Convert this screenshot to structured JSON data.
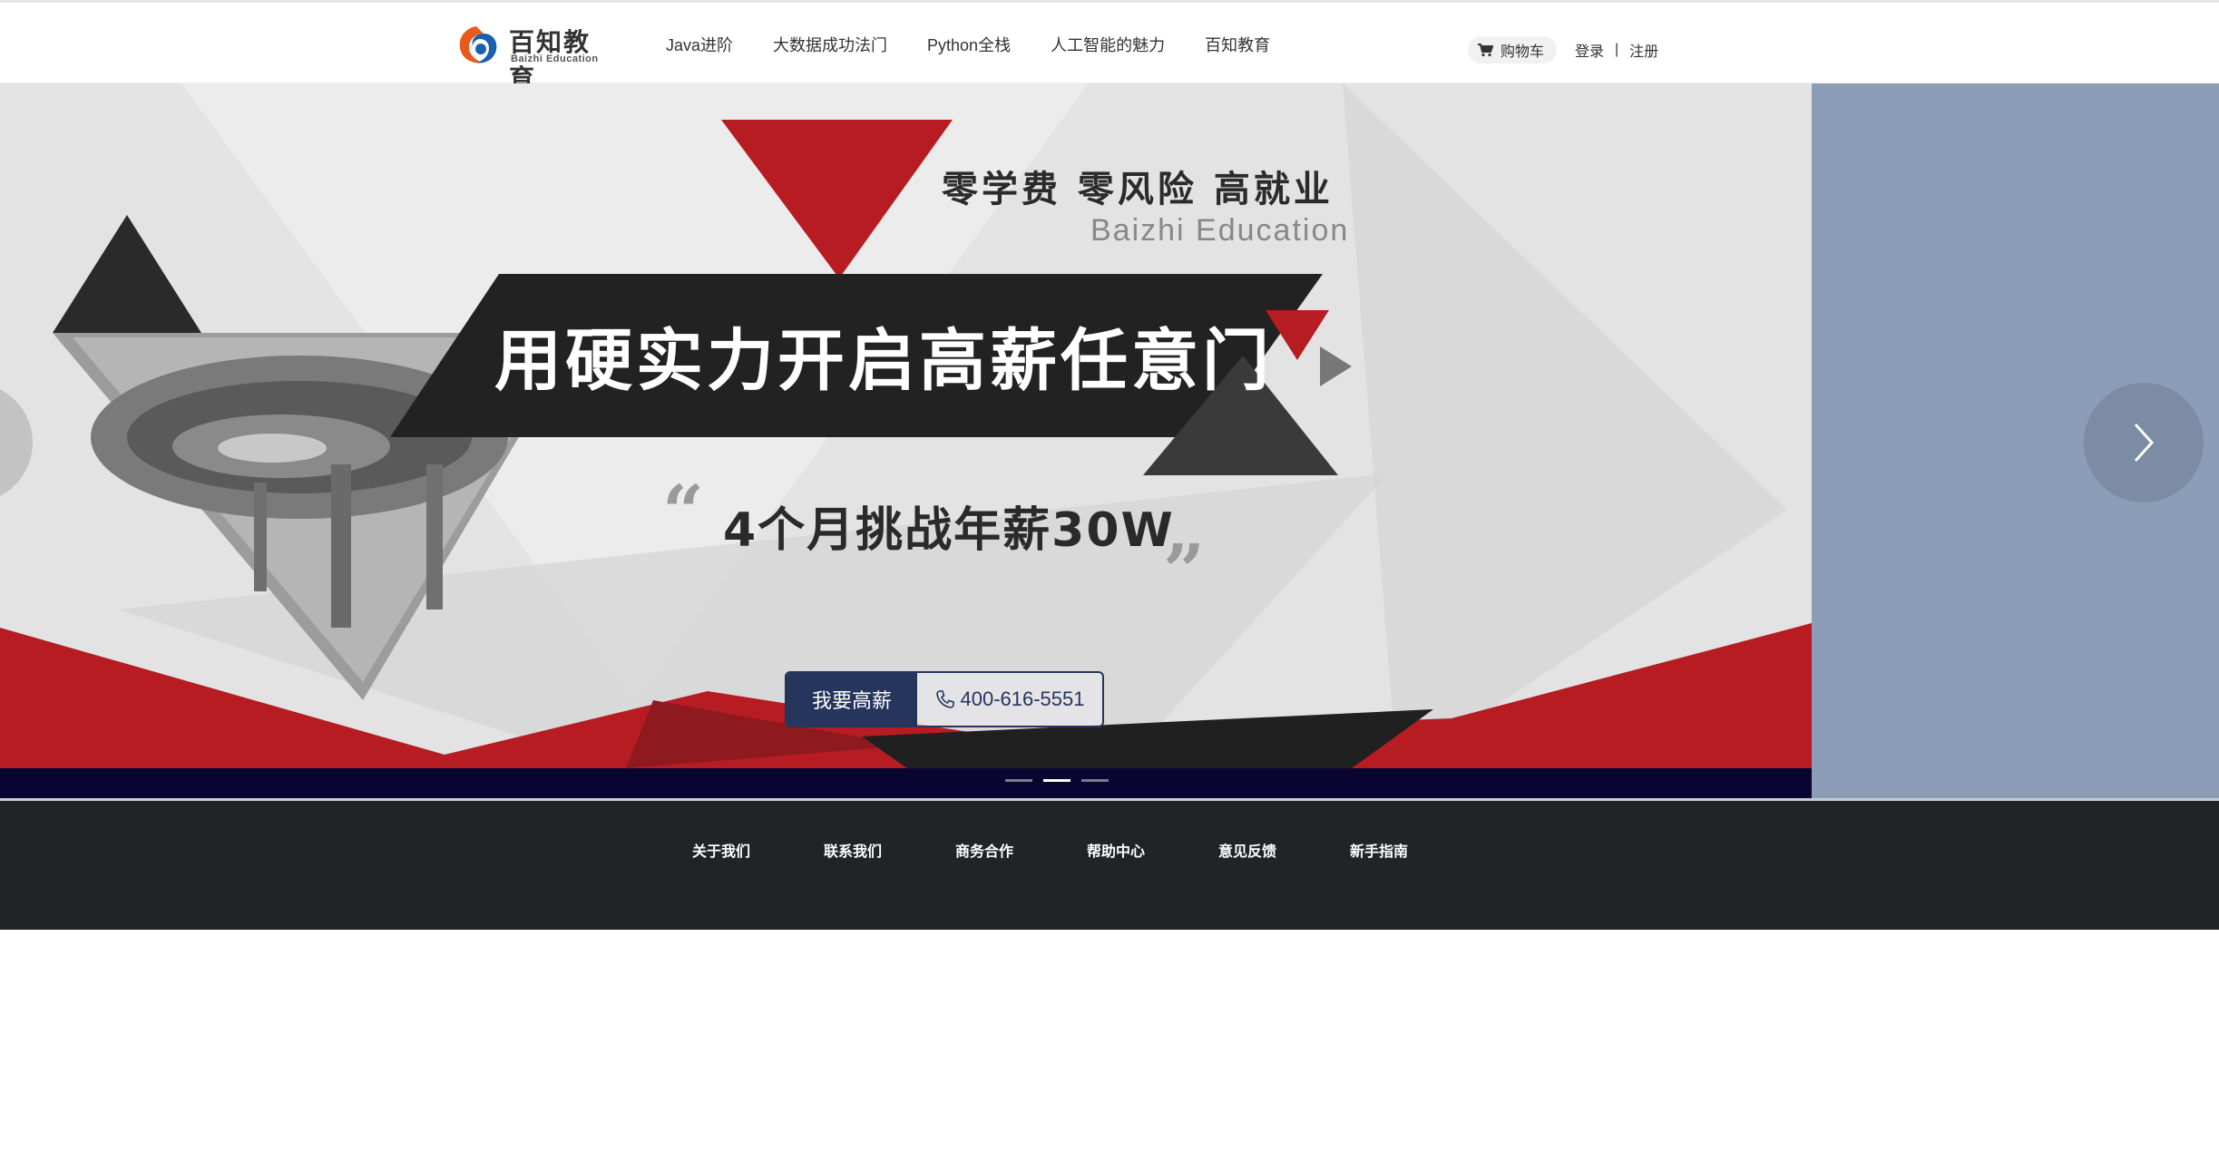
{
  "header": {
    "logo_cn": "百知教育",
    "logo_en": "Baizhi Education",
    "nav": [
      "Java进阶",
      "大数据成功法门",
      "Python全栈",
      "人工智能的魅力",
      "百知教育"
    ],
    "cart_label": "购物车",
    "login_label": "登录",
    "separator": "|",
    "register_label": "注册"
  },
  "banner": {
    "slogan": "零学费  零风险  高就业",
    "slogan_en": "Baizhi Education",
    "main_title": "用硬实力开启高薪任意门",
    "sub_title": "4个月挑战年薪30W",
    "cta_label": "我要高薪",
    "phone": "400-616-5551",
    "slides_total": 3,
    "active_slide": 2
  },
  "footer": {
    "links": [
      "关于我们",
      "联系我们",
      "商务合作",
      "帮助中心",
      "意见反馈",
      "新手指南"
    ]
  },
  "colors": {
    "brand_red": "#b71c22",
    "navy": "#25355c",
    "footer_bg": "#212327",
    "banner_side": "#8c9db7"
  }
}
